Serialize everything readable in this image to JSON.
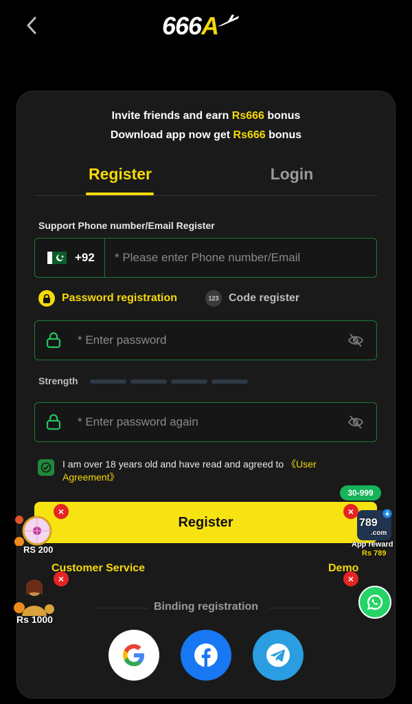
{
  "header": {
    "back_icon": "chevron-left-icon",
    "logo_main": "666",
    "logo_accent": "A"
  },
  "promo": {
    "line1_prefix": "Invite friends and earn ",
    "line1_amount": "Rs666",
    "line1_suffix": " bonus",
    "line2_prefix": "Download app now get ",
    "line2_amount": "Rs666",
    "line2_suffix": " bonus"
  },
  "tabs": {
    "register": "Register",
    "login": "Login",
    "active": "Register"
  },
  "form": {
    "section_label": "Support Phone number/Email Register",
    "country_code": "+92",
    "phone_placeholder": "* Please enter Phone number/Email",
    "option_password": "Password registration",
    "option_code": "Code register",
    "option_code_badge": "123",
    "password_placeholder": "* Enter password",
    "strength_label": "Strength",
    "strength_level": 0,
    "password_again_placeholder": "* Enter password again",
    "agree_text": "I am over 18 years old and have read and agreed to ",
    "agree_link": "《User Agreement》",
    "agreed": true,
    "register_button": "Register"
  },
  "links": {
    "customer_service": "Customer Service",
    "demo": "Demo"
  },
  "binding": {
    "label": "Binding registration",
    "providers": [
      "google-icon",
      "facebook-icon",
      "telegram-icon"
    ]
  },
  "floating": {
    "left_top_label": "RS 200",
    "left_bottom_label": "Rs 1000",
    "right_badge": "30-999",
    "right_brand": "789",
    "right_brand_sub": ".com",
    "right_label": "App reward",
    "right_amount": "Rs 789",
    "close_glyph": "×"
  },
  "colors": {
    "accent": "#f5d90a",
    "border_green": "#1f7a34",
    "card_bg": "#1a1a1a",
    "close_red": "#e52424"
  }
}
